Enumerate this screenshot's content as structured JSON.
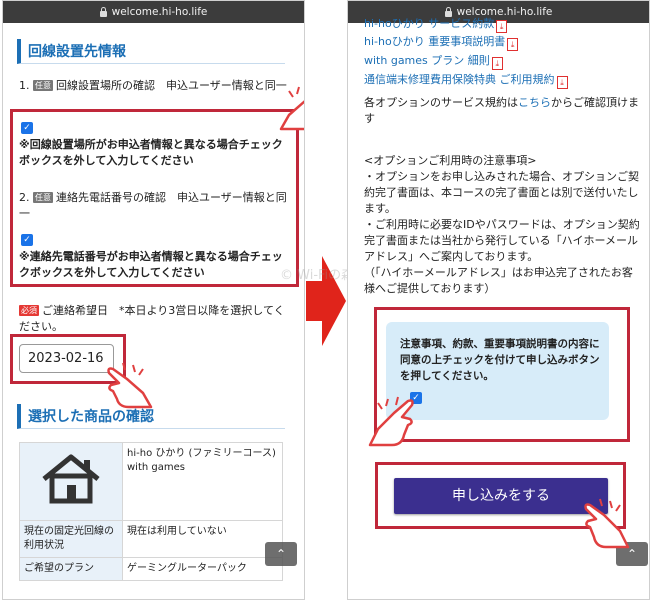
{
  "left": {
    "url": "welcome.hi-ho.life",
    "section_title": "回線設置先情報",
    "item1": {
      "number": "1.",
      "badge": "任意",
      "text": "回線設置場所の確認　申込ユーザー情報と同一"
    },
    "check1_label": "※回線設置場所がお申込者情報と異なる場合チェックボックスを外して入力してください",
    "item2": {
      "number": "2.",
      "badge": "任意",
      "text": "連絡先電話番号の確認　申込ユーザー情報と同一"
    },
    "check2_label": "※連絡先電話番号がお申込者情報と異なる場合チェックボックスを外して入力してください",
    "date_field": {
      "badge": "必須",
      "label": "ご連絡希望日　*本日より3営日以降を選択してください。",
      "value": "2023-02-16"
    },
    "product_title": "選択した商品の確認",
    "table": [
      {
        "header": "",
        "value": "hi-ho ひかり (ファミリーコース) with games"
      },
      {
        "header": "現在の固定光回線の利用状況",
        "value": "現在は利用していない"
      },
      {
        "header": "ご希望のプラン",
        "value": "ゲーミングルーターパック"
      }
    ],
    "scroll_top": "⌃"
  },
  "right": {
    "url": "welcome.hi-ho.life",
    "links": [
      "hi-hoひかり サービス約款",
      "hi-hoひかり 重要事項説明書",
      "with games プラン 細則",
      "通信端末修理費用保険特典 ご利用規約"
    ],
    "options_pre": "各オプションのサービス規約は",
    "options_link": "こちら",
    "options_post": "からご確認頂けます",
    "notes_title": "<オプションご利用時の注意事項>",
    "note1": "・オプションをお申し込みされた場合、オプションご契約完了書面は、本コースの完了書面とは別で送付いたします。",
    "note2": "・ご利用時に必要なIDやパスワードは、オプション契約完了書面または当社から発行している「ハイホーメールアドレス」へご案内しております。",
    "note3": "（「ハイホーメールアドレス」はお申込完了されたお客様へご提供しております）",
    "agree_text": "注意事項、約款、重要事項説明書の内容に同意の上チェックを付けて申し込みボタンを押してください。",
    "apply_button": "申し込みをする",
    "scroll_top": "⌃"
  },
  "watermark": "© Wi-Fiの森",
  "colors": {
    "accent": "#1c6fb5",
    "highlight": "#c0283a",
    "button": "#3b2f8f",
    "arrow": "#e0241b"
  }
}
